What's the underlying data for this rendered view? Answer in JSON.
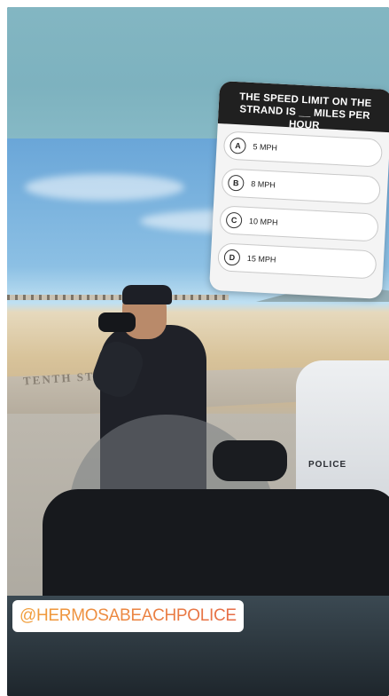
{
  "quiz": {
    "question": "THE SPEED LIMIT ON THE STRAND IS __ MILES PER HOUR",
    "options": [
      {
        "letter": "A",
        "text": "5 MPH"
      },
      {
        "letter": "B",
        "text": "8 MPH"
      },
      {
        "letter": "C",
        "text": "10 MPH"
      },
      {
        "letter": "D",
        "text": "15 MPH"
      }
    ]
  },
  "photo": {
    "wall_text": "TENTH STRE",
    "moto_label": "POLICE"
  },
  "mention": {
    "text": "@HERMOSABEACHPOLICE"
  },
  "colors": {
    "top_band": "#7db2bf",
    "bottom_band": "#1e262c",
    "quiz_header": "#202020",
    "mention_gradient_start": "#f1a13a",
    "mention_gradient_end": "#e66a47"
  }
}
